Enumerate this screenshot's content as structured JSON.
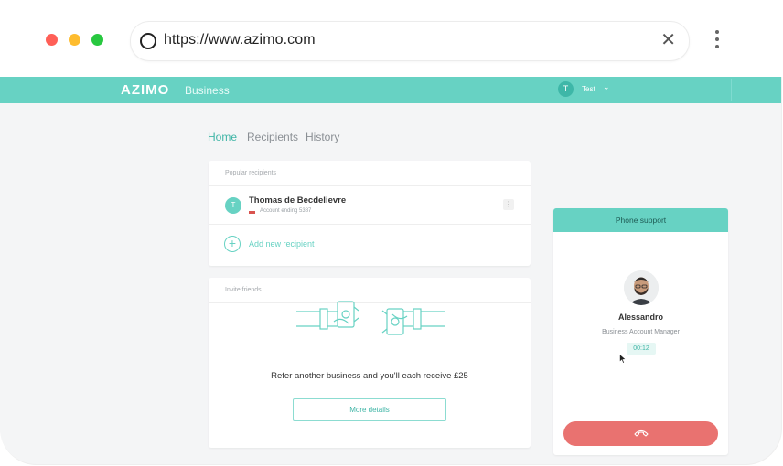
{
  "browser": {
    "url": "https://www.azimo.com",
    "close_glyph": "✕"
  },
  "app": {
    "logo": "AZIMO",
    "logo_sub": "Business",
    "user_initial": "T",
    "user_name": "Test",
    "user_chevron": "⌄"
  },
  "nav": {
    "tabs": [
      {
        "label": "Home",
        "active": true
      },
      {
        "label": "Recipients",
        "active": false
      },
      {
        "label": "History",
        "active": false
      }
    ]
  },
  "recipients": {
    "title": "Popular recipients",
    "items": [
      {
        "initial": "T",
        "name": "Thomas de Becdelievre",
        "subtitle": "Account ending 5387"
      }
    ],
    "more_glyph": "⋮",
    "add_glyph": "+",
    "add_label": "Add new recipient"
  },
  "invite": {
    "title": "Invite friends",
    "text": "Refer another business and you'll each receive £25",
    "button": "More details"
  },
  "support": {
    "header": "Phone support",
    "agent_name": "Alessandro",
    "agent_role": "Business Account Manager",
    "timer": "00:12"
  },
  "colors": {
    "accent": "#67d2c3",
    "accent_dark": "#3fb5a6",
    "hangup": "#e97270",
    "page_bg": "#f4f5f6"
  },
  "icons": {
    "address": "circle-icon",
    "close": "close-icon",
    "menu": "kebab-menu-icon",
    "more": "more-vertical-icon",
    "add": "plus-circle-icon",
    "hangup": "phone-hangup-icon",
    "cursor": "mouse-cursor-icon"
  }
}
